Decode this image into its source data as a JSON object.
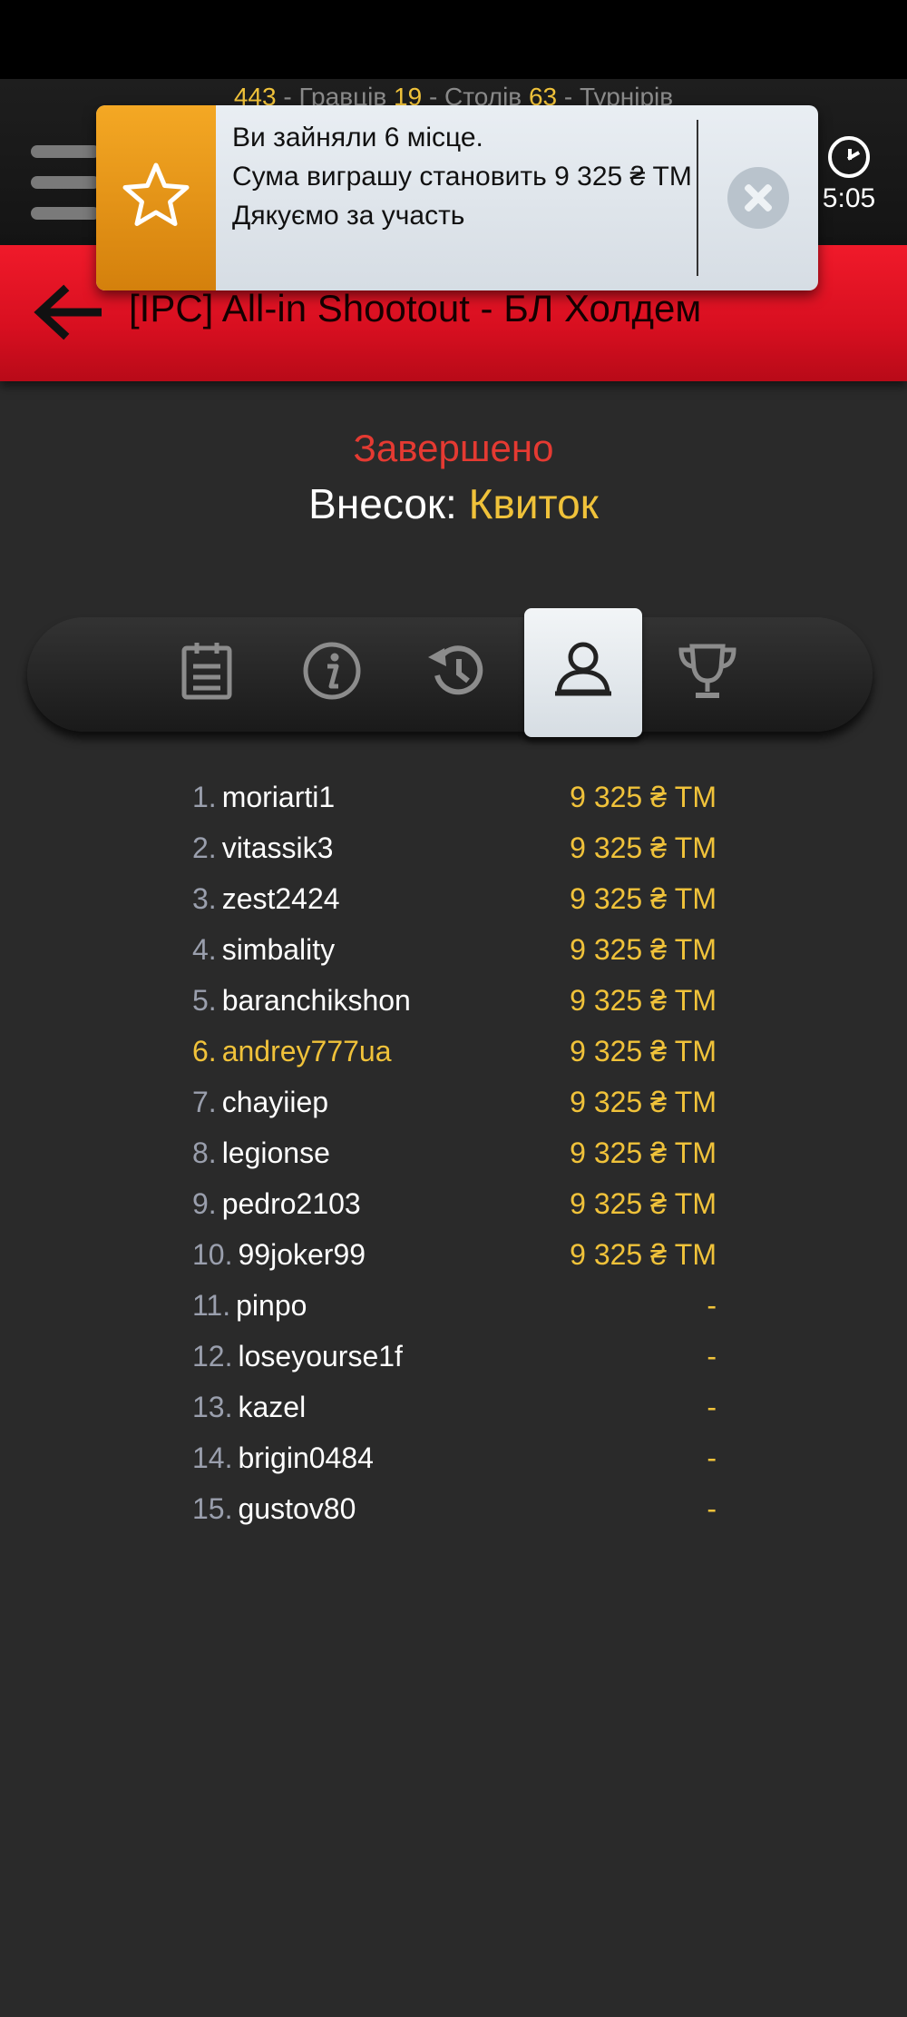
{
  "header": {
    "players_count": "443",
    "players_label": "- Гравців",
    "tables_count": "19",
    "tables_label": "- Столів",
    "tournaments_count": "63",
    "tournaments_label": "- Турнірів",
    "time": "5:05"
  },
  "toast": {
    "line1": "Ви зайняли 6 місце.",
    "line2": "Сума виграшу становить 9 325 ₴ ТМ",
    "line3": "Дякуємо за участь"
  },
  "tournament": {
    "title": "[IPC] All-in Shootout - БЛ Холдем",
    "status": "Завершено",
    "fee_label": "Внесок:",
    "fee_value": "Квиток"
  },
  "tabs": [
    {
      "icon": "clipboard-icon",
      "active": false
    },
    {
      "icon": "info-icon",
      "active": false
    },
    {
      "icon": "history-icon",
      "active": false
    },
    {
      "icon": "user-icon",
      "active": true
    },
    {
      "icon": "trophy-icon",
      "active": false
    }
  ],
  "players": [
    {
      "rank": "1.",
      "name": "moriarti1",
      "prize": "9 325 ₴ ТМ"
    },
    {
      "rank": "2.",
      "name": "vitassik3",
      "prize": "9 325 ₴ ТМ"
    },
    {
      "rank": "3.",
      "name": "zest2424",
      "prize": "9 325 ₴ ТМ"
    },
    {
      "rank": "4.",
      "name": "simbality",
      "prize": "9 325 ₴ ТМ"
    },
    {
      "rank": "5.",
      "name": "baranchikshon",
      "prize": "9 325 ₴ ТМ"
    },
    {
      "rank": "6.",
      "name": "andrey777ua",
      "prize": "9 325 ₴ ТМ"
    },
    {
      "rank": "7.",
      "name": "chayiiep",
      "prize": "9 325 ₴ ТМ"
    },
    {
      "rank": "8.",
      "name": "legionse",
      "prize": "9 325 ₴ ТМ"
    },
    {
      "rank": "9.",
      "name": "pedro2103",
      "prize": "9 325 ₴ ТМ"
    },
    {
      "rank": "10.",
      "name": "99joker99",
      "prize": "9 325 ₴ ТМ"
    },
    {
      "rank": "11.",
      "name": "pinpo",
      "prize": "-"
    },
    {
      "rank": "12.",
      "name": "loseyourse1f",
      "prize": "-"
    },
    {
      "rank": "13.",
      "name": "kazel",
      "prize": "-"
    },
    {
      "rank": "14.",
      "name": "brigin0484",
      "prize": "-"
    },
    {
      "rank": "15.",
      "name": "gustov80",
      "prize": "-"
    }
  ],
  "colors": {
    "accent": "#f0c23a",
    "status_red": "#e53a32",
    "header_red": "#e01424",
    "background": "#2a2a2a"
  }
}
